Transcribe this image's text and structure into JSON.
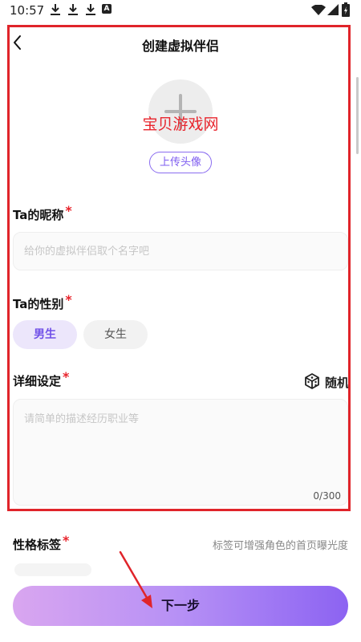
{
  "status_bar": {
    "time": "10:57",
    "icons": [
      "download-icon",
      "download-icon",
      "download-icon",
      "a-icon",
      "wifi-icon",
      "signal-icon",
      "battery-icon"
    ],
    "a_icon_text": "A"
  },
  "header": {
    "back_icon": "chevron-left-icon",
    "title": "创建虚拟伴侣"
  },
  "avatar": {
    "icon": "plus-icon",
    "watermark": "宝贝游戏网",
    "upload_label": "上传头像"
  },
  "nickname": {
    "label": "Ta的昵称",
    "required_mark": "*",
    "value": "",
    "placeholder": "给你的虚拟伴侣取个名字吧"
  },
  "gender": {
    "label": "Ta的性别",
    "required_mark": "*",
    "options": [
      "男生",
      "女生"
    ],
    "selected": "男生"
  },
  "details": {
    "label": "详细设定",
    "required_mark": "*",
    "random_label": "随机",
    "random_icon": "dice-icon",
    "value": "",
    "placeholder": "请简单的描述经历职业等",
    "counter": "0/300"
  },
  "tags": {
    "label": "性格标签",
    "required_mark": "*",
    "hint": "标签可增强角色的首页曝光度"
  },
  "footer": {
    "next_label": "下一步"
  },
  "colors": {
    "accent": "#7e5cf0",
    "required": "#e8242c",
    "highlight_frame": "#e0242a",
    "button_gradient_start": "#d9a6f0",
    "button_gradient_end": "#8c63f2",
    "selected_chip_bg": "#ece6fb"
  }
}
